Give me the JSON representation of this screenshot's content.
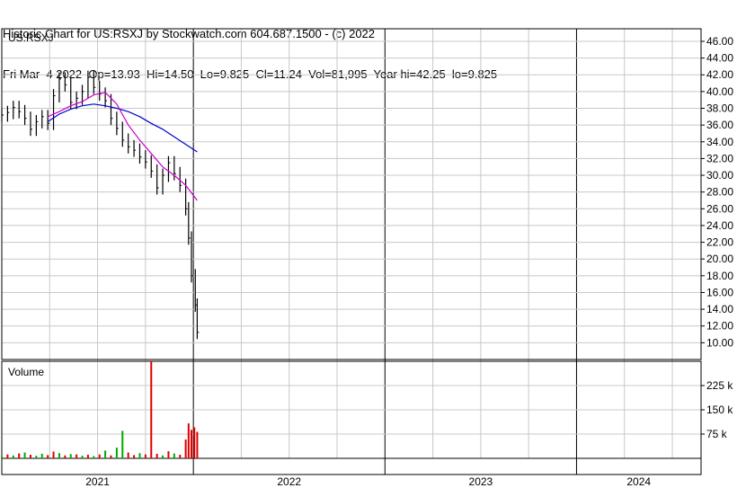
{
  "header": {
    "line1": "Historic Chart for US:RSXJ by Stockwatch.com 604.687.1500 - (c) 2022",
    "line2": "Fri Mar  4 2022  Op=13.93  Hi=14.50  Lo=9.825  Cl=11.24  Vol=81,995  Year hi=42.25  lo=9.825"
  },
  "chart_data": {
    "type": "candlestick",
    "ticker": "US:RSXJ",
    "price_axis": {
      "ticks": [
        "46.00",
        "44.00",
        "42.00",
        "40.00",
        "38.00",
        "36.00",
        "34.00",
        "32.00",
        "30.00",
        "28.00",
        "26.00",
        "24.00",
        "22.00",
        "20.00",
        "18.00",
        "16.00",
        "14.00",
        "12.00",
        "10.00"
      ],
      "range": [
        8.0,
        47.5
      ]
    },
    "volume_panel_title": "Volume",
    "volume_axis": {
      "ticks": [
        "225 k",
        "150 k",
        "75 k"
      ],
      "range": [
        0,
        300000
      ]
    },
    "x_axis": {
      "years": [
        "2021",
        "2022",
        "2023",
        "2024"
      ]
    },
    "price_series": [
      [
        2021.0,
        37.2
      ],
      [
        2021.03,
        37.5
      ],
      [
        2021.06,
        38.1
      ],
      [
        2021.09,
        37.6
      ],
      [
        2021.12,
        36.8
      ],
      [
        2021.15,
        35.5
      ],
      [
        2021.18,
        36.4
      ],
      [
        2021.21,
        37.0
      ],
      [
        2021.24,
        36.2
      ],
      [
        2021.27,
        39.5
      ],
      [
        2021.3,
        41.5
      ],
      [
        2021.33,
        40.8
      ],
      [
        2021.36,
        38.7
      ],
      [
        2021.39,
        39.2
      ],
      [
        2021.42,
        40.0
      ],
      [
        2021.45,
        41.7
      ],
      [
        2021.48,
        40.5
      ],
      [
        2021.51,
        39.7
      ],
      [
        2021.54,
        38.9
      ],
      [
        2021.57,
        36.8
      ],
      [
        2021.6,
        35.6
      ],
      [
        2021.63,
        34.2
      ],
      [
        2021.66,
        33.4
      ],
      [
        2021.69,
        33.0
      ],
      [
        2021.72,
        32.2
      ],
      [
        2021.75,
        31.6
      ],
      [
        2021.78,
        30.5
      ],
      [
        2021.81,
        28.5
      ],
      [
        2021.84,
        30.0
      ],
      [
        2021.87,
        31.5
      ],
      [
        2021.9,
        30.2
      ],
      [
        2021.93,
        28.8
      ],
      [
        2021.96,
        26.0
      ],
      [
        2021.975,
        22.5
      ],
      [
        2021.99,
        18.0
      ],
      [
        2022.01,
        14.5
      ],
      [
        2022.02,
        11.24
      ]
    ],
    "ma_short_color": "#cc00cc",
    "ma_short": [
      [
        2021.24,
        37.0
      ],
      [
        2021.3,
        37.6
      ],
      [
        2021.36,
        38.3
      ],
      [
        2021.42,
        38.8
      ],
      [
        2021.48,
        39.6
      ],
      [
        2021.54,
        39.9
      ],
      [
        2021.6,
        38.5
      ],
      [
        2021.66,
        36.0
      ],
      [
        2021.72,
        34.2
      ],
      [
        2021.78,
        32.6
      ],
      [
        2021.84,
        31.0
      ],
      [
        2021.9,
        30.0
      ],
      [
        2021.96,
        28.8
      ],
      [
        2022.02,
        27.0
      ]
    ],
    "ma_long_color": "#0000cc",
    "ma_long": [
      [
        2021.24,
        36.4
      ],
      [
        2021.3,
        37.3
      ],
      [
        2021.36,
        37.9
      ],
      [
        2021.42,
        38.3
      ],
      [
        2021.48,
        38.5
      ],
      [
        2021.54,
        38.3
      ],
      [
        2021.6,
        38.0
      ],
      [
        2021.66,
        37.6
      ],
      [
        2021.72,
        37.0
      ],
      [
        2021.78,
        36.2
      ],
      [
        2021.84,
        35.5
      ],
      [
        2021.9,
        34.6
      ],
      [
        2021.96,
        33.7
      ],
      [
        2022.02,
        32.8
      ]
    ],
    "volume_series": [
      [
        2021.0,
        6000,
        "g"
      ],
      [
        2021.03,
        12000,
        "r"
      ],
      [
        2021.06,
        9000,
        "g"
      ],
      [
        2021.09,
        15000,
        "r"
      ],
      [
        2021.12,
        18000,
        "g"
      ],
      [
        2021.15,
        11000,
        "r"
      ],
      [
        2021.18,
        8000,
        "g"
      ],
      [
        2021.21,
        14000,
        "g"
      ],
      [
        2021.24,
        10000,
        "r"
      ],
      [
        2021.27,
        21000,
        "r"
      ],
      [
        2021.3,
        16000,
        "g"
      ],
      [
        2021.33,
        9000,
        "r"
      ],
      [
        2021.36,
        13000,
        "g"
      ],
      [
        2021.39,
        12000,
        "r"
      ],
      [
        2021.42,
        8000,
        "g"
      ],
      [
        2021.45,
        11000,
        "r"
      ],
      [
        2021.48,
        7000,
        "g"
      ],
      [
        2021.51,
        12000,
        "r"
      ],
      [
        2021.54,
        24000,
        "g"
      ],
      [
        2021.57,
        9000,
        "r"
      ],
      [
        2021.6,
        33000,
        "g"
      ],
      [
        2021.63,
        85000,
        "g"
      ],
      [
        2021.66,
        18000,
        "r"
      ],
      [
        2021.69,
        10000,
        "r"
      ],
      [
        2021.72,
        16000,
        "g"
      ],
      [
        2021.75,
        12000,
        "r"
      ],
      [
        2021.78,
        310000,
        "r"
      ],
      [
        2021.81,
        14000,
        "r"
      ],
      [
        2021.84,
        9000,
        "g"
      ],
      [
        2021.87,
        22000,
        "r"
      ],
      [
        2021.9,
        15000,
        "g"
      ],
      [
        2021.93,
        11000,
        "r"
      ],
      [
        2021.96,
        58000,
        "r"
      ],
      [
        2021.975,
        108000,
        "r"
      ],
      [
        2021.99,
        88000,
        "r"
      ],
      [
        2022.005,
        96000,
        "r"
      ],
      [
        2022.02,
        82000,
        "r"
      ]
    ],
    "up_color": "#00aa00",
    "down_color": "#dd0000",
    "grid": true
  }
}
